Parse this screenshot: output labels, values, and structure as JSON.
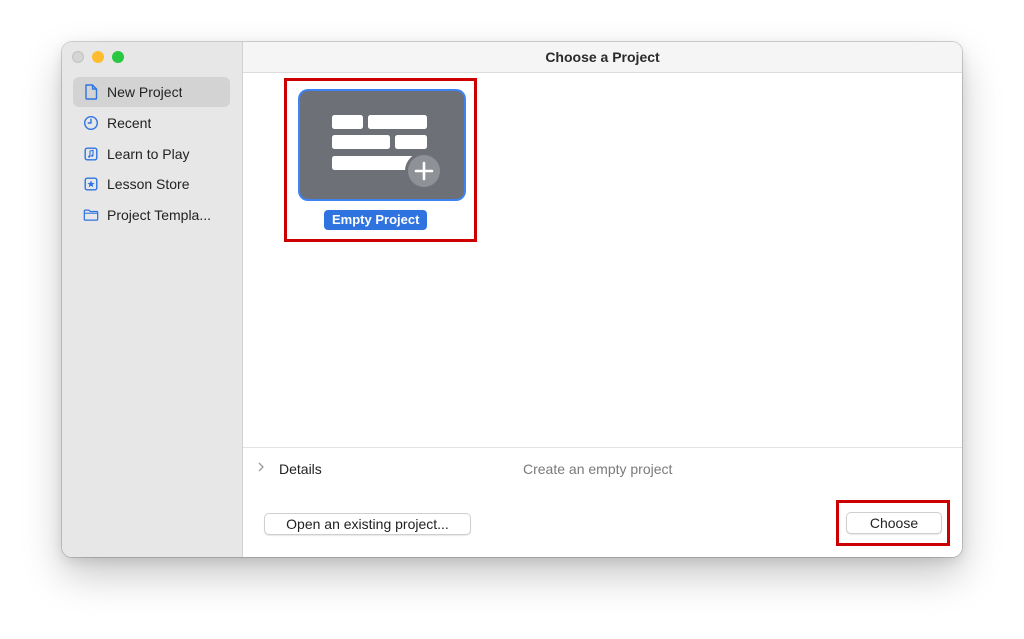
{
  "window": {
    "title": "Choose a Project"
  },
  "sidebar": {
    "items": [
      {
        "label": "New Project",
        "icon": "document-icon",
        "selected": true
      },
      {
        "label": "Recent",
        "icon": "clock-icon",
        "selected": false
      },
      {
        "label": "Learn to Play",
        "icon": "music-note-icon",
        "selected": false
      },
      {
        "label": "Lesson Store",
        "icon": "star-icon",
        "selected": false
      },
      {
        "label": "Project Templa...",
        "icon": "folder-icon",
        "selected": false
      }
    ]
  },
  "main": {
    "templates": [
      {
        "label": "Empty Project",
        "icon": "empty-project-icon",
        "selected": true
      }
    ]
  },
  "details": {
    "label": "Details",
    "description": "Create an empty project"
  },
  "footer": {
    "open_label": "Open an existing project...",
    "choose_label": "Choose"
  },
  "colors": {
    "accent": "#2f73e0",
    "selection_border": "#3f83f1",
    "sidebar_bg": "#e7e7e7",
    "sidebar_selected_bg": "#d3d3d3",
    "annotation_red": "#cc0000",
    "card_bg": "#6d7177"
  }
}
